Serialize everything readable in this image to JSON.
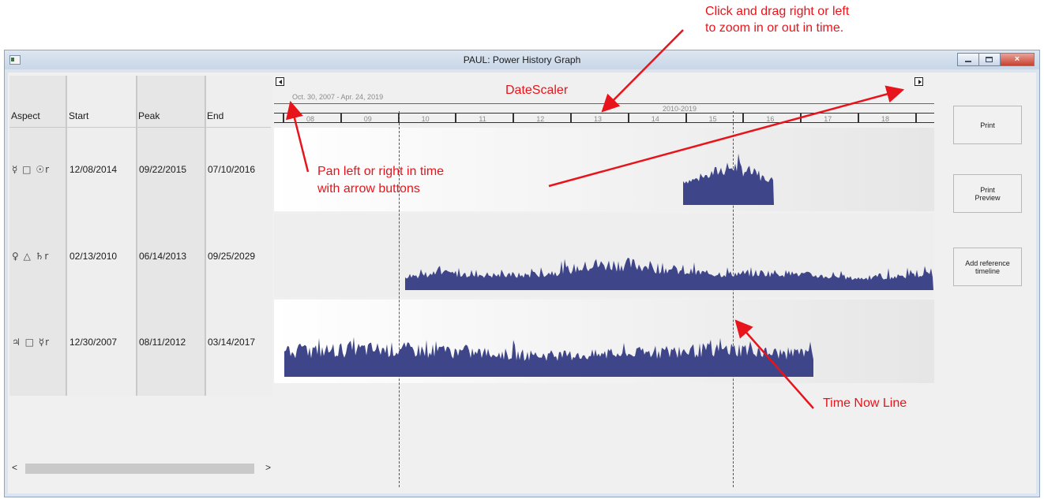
{
  "window": {
    "title": "PAUL: Power History Graph"
  },
  "controls": {
    "close_glyph": "×"
  },
  "table": {
    "headers": {
      "aspect": "Aspect",
      "start": "Start",
      "peak": "Peak",
      "end": "End"
    },
    "rows": [
      {
        "aspect": "☿ □ ☉r",
        "start": "12/08/2014",
        "peak": "09/22/2015",
        "end": "07/10/2016"
      },
      {
        "aspect": "♀ △ ♄r",
        "start": "02/13/2010",
        "peak": "06/14/2013",
        "end": "09/25/2029"
      },
      {
        "aspect": "♃ □ ☿r",
        "start": "12/30/2007",
        "peak": "08/11/2012",
        "end": "03/14/2017"
      }
    ]
  },
  "scrollbar": {
    "left": "<",
    "right": ">"
  },
  "datescaler": {
    "range_label": "Oct. 30, 2007 - Apr. 24, 2019",
    "decade_label": "2010-2019",
    "years": [
      "08",
      "09",
      "10",
      "11",
      "12",
      "13",
      "14",
      "15",
      "16",
      "17",
      "18"
    ]
  },
  "buttons": {
    "print": "Print",
    "print_preview_1": "Print",
    "print_preview_2": "Preview",
    "add_reference_1": "Add reference",
    "add_reference_2": "timeline"
  },
  "annotations": {
    "zoom_1": "Click and drag right or left",
    "zoom_2": "to zoom in or out in time.",
    "datescaler": "DateScaler",
    "pan_1": "Pan left or right in time",
    "pan_2": "with arrow buttons",
    "time_now": "Time Now Line"
  },
  "colors": {
    "graph_fill": "#3e4589",
    "annotation": "#e8141b",
    "window_chrome": "#dbe4ef"
  }
}
